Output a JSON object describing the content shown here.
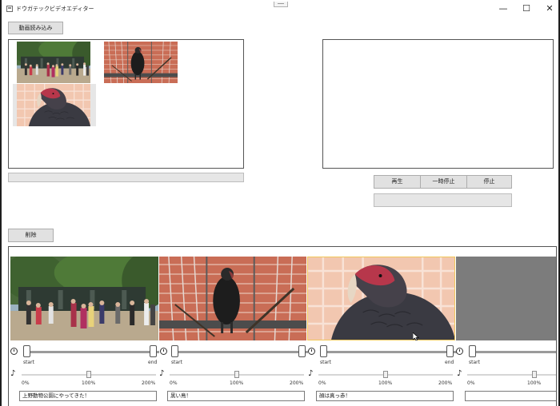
{
  "window": {
    "title": "ドウガテックビデオエディター",
    "controls": {
      "minimize": "—",
      "maximize": "☐",
      "close": "✕"
    }
  },
  "toolbar": {
    "load_video_label": "動画読み込み",
    "delete_label": "削除"
  },
  "library": {
    "thumbnails": [
      {
        "subject": "zoo entrance crowd"
      },
      {
        "subject": "black bird in cage"
      },
      {
        "subject": "bird closeup"
      }
    ],
    "progress_percent": 0
  },
  "player": {
    "play_label": "再生",
    "pause_label": "一時停止",
    "stop_label": "停止",
    "progress_percent": 0
  },
  "timeline": {
    "start_label": "start",
    "end_label": "end",
    "volume_ticks": [
      "0%",
      "100%",
      "200%"
    ],
    "clips": [
      {
        "subject": "zoo entrance crowd",
        "caption": "上野動物公園にやってきた！",
        "volume_percent": 100,
        "selected": false
      },
      {
        "subject": "black bird in cage",
        "caption": "黒い鳥！",
        "volume_percent": 100,
        "selected": false
      },
      {
        "subject": "bird closeup",
        "caption": "顔は真っ赤！",
        "volume_percent": 100,
        "selected": true
      },
      {
        "subject": "empty",
        "caption": "",
        "volume_percent": 100,
        "selected": false
      }
    ]
  },
  "icons": {
    "app": "app-icon",
    "timer": "stopwatch-icon",
    "volume": "music-note-icon"
  },
  "colors": {
    "selection_border": "#f1c85a",
    "empty_clip": "#7c7c7c",
    "button_face": "#e1e1e1"
  }
}
